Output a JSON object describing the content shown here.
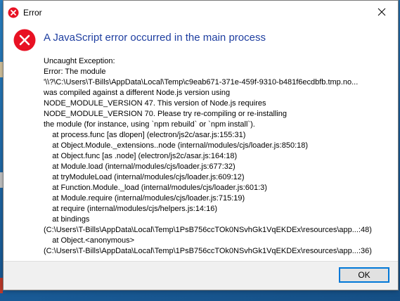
{
  "window": {
    "title": "Error",
    "close_icon": "close-icon",
    "title_icon": "error-icon"
  },
  "main": {
    "icon": "error-icon",
    "heading": "A JavaScript error occurred in the main process",
    "heading_color": "#1e3ea0",
    "message_lines": [
      "Uncaught Exception:",
      "Error: The module",
      "'\\\\?\\C:\\Users\\T-Bills\\AppData\\Local\\Temp\\c9eab671-371e-459f-9310-b481f6ecdbfb.tmp.no...",
      "was compiled against a different Node.js version using",
      "NODE_MODULE_VERSION 47. This version of Node.js requires",
      "NODE_MODULE_VERSION 70. Please try re-compiling or re-installing",
      "the module (for instance, using `npm rebuild` or `npm install`).",
      "    at process.func [as dlopen] (electron/js2c/asar.js:155:31)",
      "    at Object.Module._extensions..node (internal/modules/cjs/loader.js:850:18)",
      "    at Object.func [as .node] (electron/js2c/asar.js:164:18)",
      "    at Module.load (internal/modules/cjs/loader.js:677:32)",
      "    at tryModuleLoad (internal/modules/cjs/loader.js:609:12)",
      "    at Function.Module._load (internal/modules/cjs/loader.js:601:3)",
      "    at Module.require (internal/modules/cjs/loader.js:715:19)",
      "    at require (internal/modules/cjs/helpers.js:14:16)",
      "    at bindings",
      "(C:\\Users\\T-Bills\\AppData\\Local\\Temp\\1PsB756ccTOk0NSvhGk1VqEKDEx\\resources\\app...:48)",
      "    at Object.<anonymous>",
      "(C:\\Users\\T-Bills\\AppData\\Local\\Temp\\1PsB756ccTOk0NSvhGk1VqEKDEx\\resources\\app...:36)"
    ]
  },
  "footer": {
    "ok_label": "OK"
  },
  "colors": {
    "error_red": "#e81123",
    "button_border": "#0078d7"
  }
}
